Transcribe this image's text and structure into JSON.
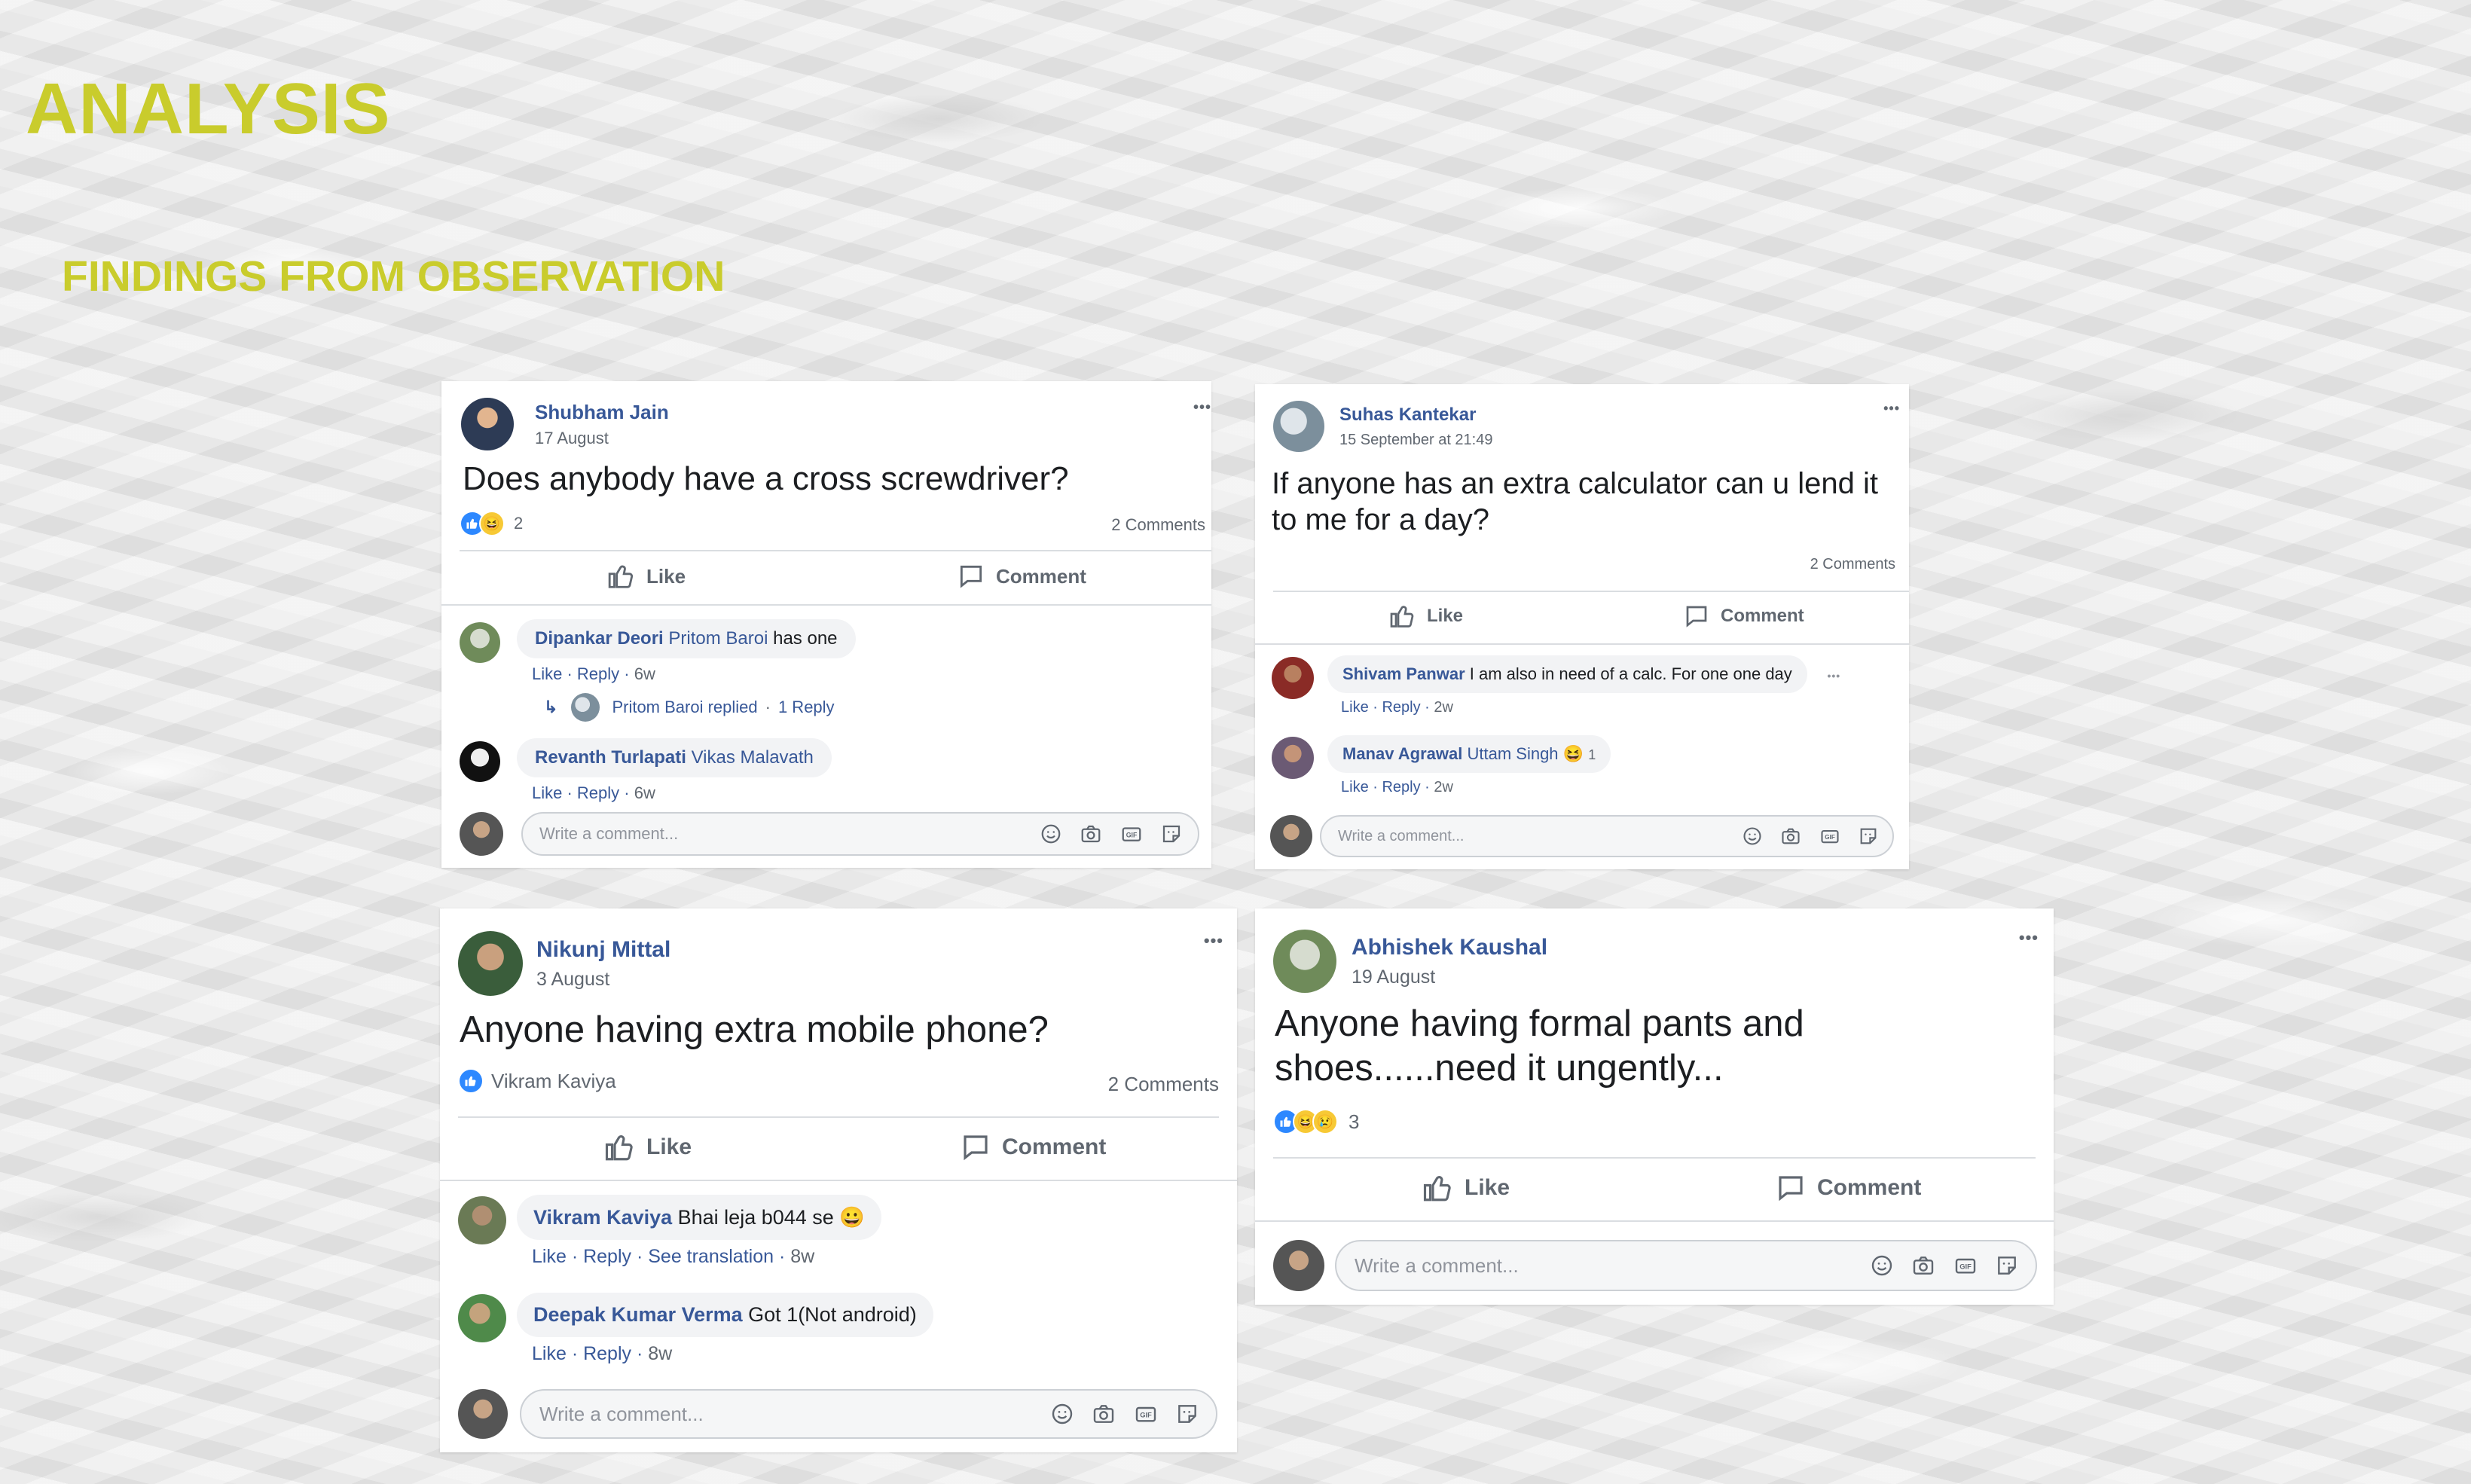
{
  "slide": {
    "title": "ANALYSIS",
    "subtitle": "FINDINGS FROM OBSERVATION"
  },
  "ui": {
    "like_label": "Like",
    "comment_label": "Comment",
    "write_placeholder": "Write a comment...",
    "reply_label": "Reply",
    "see_translation": "See translation",
    "more_dots": "•••",
    "reply_arrow": "↳"
  },
  "posts": [
    {
      "author": "Shubham Jain",
      "date": "17 August",
      "text": "Does anybody have a cross screwdriver?",
      "reaction_count": "2",
      "comments_count": "2 Comments",
      "comments": [
        {
          "name": "Dipankar Deori",
          "mention": "Pritom Baroi",
          "text": " has one",
          "time": "6w"
        },
        {
          "name": "Revanth Turlapati",
          "mention": "Vikas Malavath",
          "text": "",
          "time": "6w"
        }
      ],
      "reply_summary": "Pritom Baroi replied",
      "reply_count": "1 Reply"
    },
    {
      "author": "Suhas Kantekar",
      "date": "15 September at 21:49",
      "text": "If anyone has an extra calculator can u lend it to me for a day?",
      "comments_count": "2 Comments",
      "comments": [
        {
          "name": "Shivam Panwar",
          "mention": "",
          "text": " I am also in need of a calc. For one one day",
          "time": "2w"
        },
        {
          "name": "Manav Agrawal",
          "mention": "Uttam Singh",
          "text": "",
          "time": "2w",
          "reaction_count": "1"
        }
      ]
    },
    {
      "author": "Nikunj Mittal",
      "date": "3 August",
      "text": "Anyone having extra mobile phone?",
      "reaction_by": "Vikram Kaviya",
      "comments_count": "2 Comments",
      "comments": [
        {
          "name": "Vikram Kaviya",
          "mention": "",
          "text": " Bhai leja b044 se",
          "time": "8w"
        },
        {
          "name": "Deepak Kumar Verma",
          "mention": "",
          "text": " Got 1(Not android)",
          "time": "8w"
        }
      ]
    },
    {
      "author": "Abhishek Kaushal",
      "date": "19 August",
      "text": "Anyone having formal pants and shoes......need it ungently...",
      "reaction_count": "3"
    }
  ],
  "colors": {
    "title": "#c9cc2c",
    "fb_blue": "#385898",
    "meta_gray": "#606770"
  }
}
